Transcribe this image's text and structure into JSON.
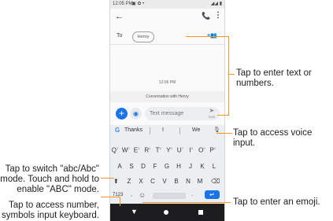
{
  "status_bar": {
    "time": "12:05 PM",
    "left_icons": "▣ ✿ •",
    "right_icons": "◢◢ ▮"
  },
  "app_bar": {
    "back_icon": "←",
    "call_icon": "📞",
    "more_icon": "⋮"
  },
  "recipient": {
    "to_label": "To",
    "chip": "Henry",
    "add_icon": "+👥"
  },
  "conversation": {
    "timestamp": "12:06 PM",
    "banner": "Conversation with Henry"
  },
  "compose": {
    "plus_icon": "+",
    "gallery_icon": "◉",
    "placeholder": "Text message",
    "send_icon": "➤",
    "send_label": "SMS"
  },
  "suggestions": {
    "g_icon": "G",
    "items": [
      "Thanks",
      "I",
      "We"
    ],
    "mic_icon": "🎙"
  },
  "keyboard": {
    "row1": [
      {
        "k": "Q",
        "sup": "1"
      },
      {
        "k": "W",
        "sup": "2"
      },
      {
        "k": "E",
        "sup": "3"
      },
      {
        "k": "R",
        "sup": "4"
      },
      {
        "k": "T",
        "sup": "5"
      },
      {
        "k": "Y",
        "sup": "6"
      },
      {
        "k": "U",
        "sup": "7"
      },
      {
        "k": "I",
        "sup": "8"
      },
      {
        "k": "O",
        "sup": "9"
      },
      {
        "k": "P",
        "sup": "0"
      }
    ],
    "row2": [
      "A",
      "S",
      "D",
      "F",
      "G",
      "H",
      "J",
      "K",
      "L"
    ],
    "row3": [
      "Z",
      "X",
      "C",
      "V",
      "B",
      "N",
      "M"
    ],
    "shift_icon": "⬆",
    "backspace_icon": "⌫",
    "num_key": "7123",
    "comma": ",",
    "emoji_icon": "☺",
    "period": ".",
    "enter_icon": "↵"
  },
  "nav": {
    "back_icon": "▼"
  },
  "callouts": {
    "enter_text": "Tap to enter text or\nnumbers.",
    "voice": "Tap to access voice input.",
    "switch_case": "Tap to switch \"abc/Abc\"\nmode. Touch and hold to\nenable \"ABC\" mode.",
    "numbers": "Tap to access number,\nsymbols input keyboard.",
    "emoji": "Tap to enter an emoji."
  },
  "colors": {
    "accent": "#1a73e8",
    "callout_line": "#f7941d",
    "navbar": "#1d1d1f"
  }
}
